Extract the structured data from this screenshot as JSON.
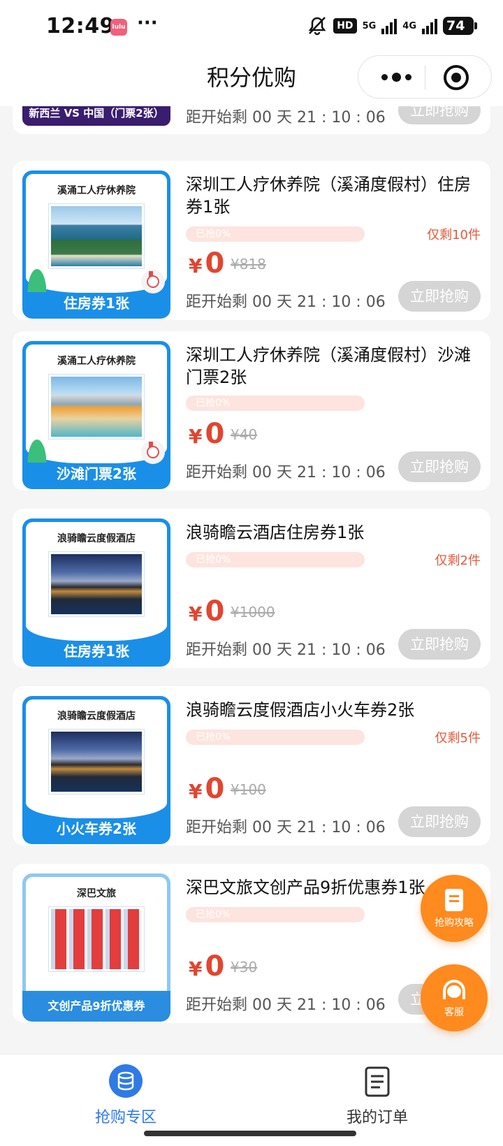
{
  "status_bar": {
    "time": "12:49",
    "app_icon_text": "lulu",
    "more_dots": "···",
    "hd_badge": "HD",
    "net_5g": "5G",
    "net_4g": "4G",
    "battery": "74"
  },
  "nav": {
    "title": "积分优购"
  },
  "partial_card": {
    "badge": "新西兰 VS 中国（门票2张）",
    "countdown": "距开始剩 00 天 21 : 10 : 06",
    "buy": "立即抢购"
  },
  "products": [
    {
      "thumb_title": "溪涌工人疗休养院",
      "thumb_band": "住房券1张",
      "title": "深圳工人疗休养院（溪涌度假村）住房券1张",
      "progress": "已抢0%",
      "progress_value": 0,
      "stock": "仅剩10件",
      "currency": "¥",
      "price": "0",
      "original_price": "¥818",
      "countdown": "距开始剩 00 天 21 : 10 : 06",
      "buy": "立即抢购"
    },
    {
      "thumb_title": "溪涌工人疗休养院",
      "thumb_band": "沙滩门票2张",
      "title": "深圳工人疗休养院（溪涌度假村）沙滩门票2张",
      "progress": "已抢0%",
      "progress_value": 0,
      "stock": "",
      "currency": "¥",
      "price": "0",
      "original_price": "¥40",
      "countdown": "距开始剩 00 天 21 : 10 : 06",
      "buy": "立即抢购"
    },
    {
      "thumb_title": "浪骑瞻云度假酒店",
      "thumb_band": "住房券1张",
      "title": "浪骑瞻云酒店住房券1张",
      "progress": "已抢0%",
      "progress_value": 0,
      "stock": "仅剩2件",
      "currency": "¥",
      "price": "0",
      "original_price": "¥1000",
      "countdown": "距开始剩 00 天 21 : 10 : 06",
      "buy": "立即抢购"
    },
    {
      "thumb_title": "浪骑瞻云度假酒店",
      "thumb_band": "小火车券2张",
      "title": "浪骑瞻云度假酒店小火车券2张",
      "progress": "已抢0%",
      "progress_value": 0,
      "stock": "仅剩5件",
      "currency": "¥",
      "price": "0",
      "original_price": "¥100",
      "countdown": "距开始剩 00 天 21 : 10 : 06",
      "buy": "立即抢购"
    },
    {
      "thumb_title": "深巴文旅",
      "thumb_band": "文创产品9折优惠券",
      "title": "深巴文旅文创产品9折优惠券1张",
      "progress": "已抢0%",
      "progress_value": 0,
      "stock": "",
      "currency": "¥",
      "price": "0",
      "original_price": "¥30",
      "countdown": "距开始剩 00 天 21 : 10 : 06",
      "buy": "立即抢购"
    }
  ],
  "floating": {
    "guide": "抢购攻略",
    "service": "客服"
  },
  "tabs": [
    {
      "label": "抢购专区",
      "active": true
    },
    {
      "label": "我的订单",
      "active": false
    }
  ],
  "colors": {
    "accent_blue": "#1a8fe8",
    "price_red": "#e2452f",
    "fab_orange": "#ff8a1e",
    "tab_active": "#2f7ae5"
  }
}
